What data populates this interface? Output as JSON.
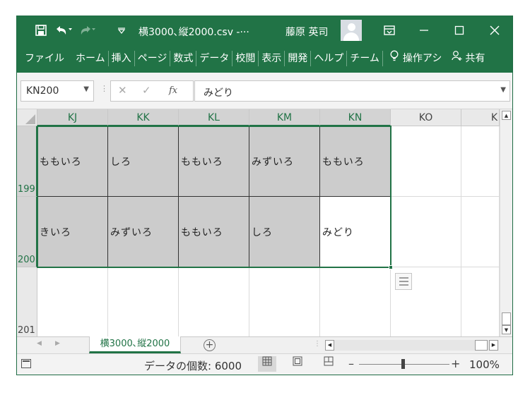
{
  "titlebar": {
    "title": "横3000､縦2000.csv -···",
    "user": "藤原 英司",
    "save_icon": "save-icon",
    "undo_icon": "undo-icon",
    "redo_icon": "redo-icon"
  },
  "ribbon": {
    "tabs": [
      "ファイル",
      "ホーム",
      "挿入",
      "ページ",
      "数式",
      "データ",
      "校閲",
      "表示",
      "開発",
      "ヘルプ",
      "チーム",
      "操作アシ",
      "共有"
    ]
  },
  "formula_bar": {
    "name_box": "KN200",
    "content": "みどり",
    "fx": "fx"
  },
  "grid": {
    "columns": [
      "KJ",
      "KK",
      "KL",
      "KM",
      "KN",
      "KO",
      "K"
    ],
    "rows": [
      {
        "number": "199",
        "cells": [
          "ももいろ",
          "しろ",
          "ももいろ",
          "みずいろ",
          "ももいろ",
          "",
          ""
        ]
      },
      {
        "number": "200",
        "cells": [
          "きいろ",
          "みずいろ",
          "ももいろ",
          "しろ",
          "みどり",
          "",
          ""
        ]
      },
      {
        "number": "201",
        "cells": [
          "",
          "",
          "",
          "",
          "",
          "",
          ""
        ]
      }
    ]
  },
  "sheet_tabs": {
    "active": "横3000､縦2000"
  },
  "status": {
    "count": "データの個数: 6000",
    "zoom": "100%"
  },
  "colors": {
    "accent": "#217346",
    "selection_fill": "#cccccc"
  }
}
